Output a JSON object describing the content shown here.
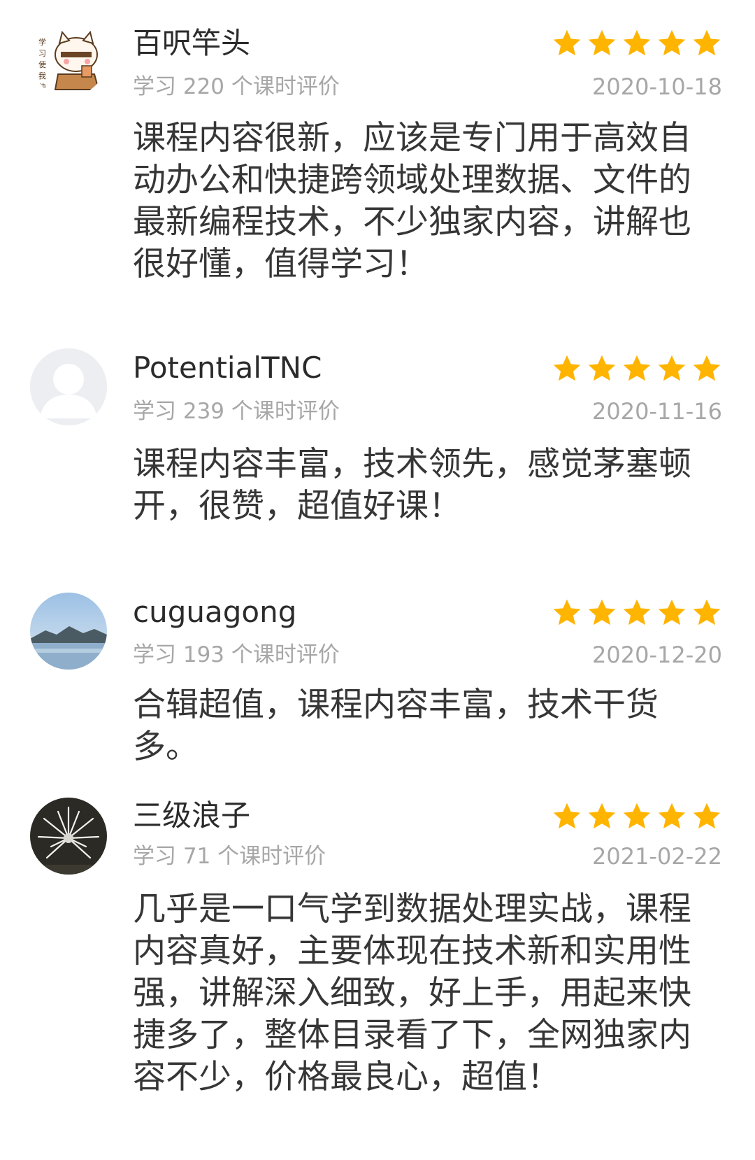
{
  "colors": {
    "star": "#FFB400",
    "meta_text": "#A7A7A7",
    "body_text": "#363636"
  },
  "reviews": [
    {
      "username": "百呎竿头",
      "avatar": "cartoon-cat-avatar",
      "stats": "学习 220 个课时评价",
      "date": "2020-10-18",
      "rating": 5,
      "content": "课程内容很新，应该是专门用于高效自动办公和快捷跨领域处理数据、文件的最新编程技术，不少独家内容，讲解也很好懂，值得学习！"
    },
    {
      "username": "PotentialTNC",
      "avatar": "default-user-avatar",
      "stats": "学习 239 个课时评价",
      "date": "2020-11-16",
      "rating": 5,
      "content": "课程内容丰富，技术领先，感觉茅塞顿开，很赞，超值好课！"
    },
    {
      "username": "cuguagong",
      "avatar": "landscape-avatar",
      "stats": "学习 193 个课时评价",
      "date": "2020-12-20",
      "rating": 5,
      "content": "合辑超值，课程内容丰富，技术干货多。"
    },
    {
      "username": "三级浪子",
      "avatar": "flower-avatar",
      "stats": "学习 71 个课时评价",
      "date": "2021-02-22",
      "rating": 5,
      "content": "几乎是一口气学到数据处理实战，课程内容真好，主要体现在技术新和实用性强，讲解深入细致，好上手，用起来快捷多了，整体目录看了下，全网独家内容不少，价格最良心，超值！"
    }
  ]
}
